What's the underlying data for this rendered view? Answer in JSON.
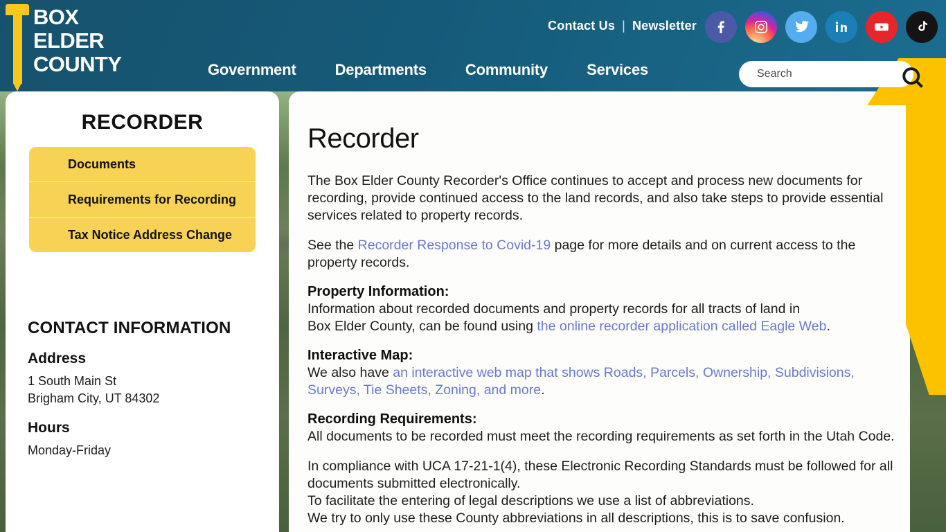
{
  "header": {
    "logo_lines": [
      "BOX",
      "ELDER",
      "COUNTY"
    ],
    "logo_icon": "nail-icon",
    "utility": {
      "contact_label": "Contact Us",
      "separator": "|",
      "newsletter_label": "Newsletter"
    },
    "socials": [
      {
        "name": "facebook",
        "label": "Facebook",
        "color": "#4b5aa7"
      },
      {
        "name": "instagram",
        "label": "Instagram",
        "color": "#d6249f"
      },
      {
        "name": "twitter",
        "label": "Twitter",
        "color": "#55acee"
      },
      {
        "name": "linkedin",
        "label": "LinkedIn",
        "color": "#1c7eb6"
      },
      {
        "name": "youtube",
        "label": "YouTube",
        "color": "#e8252a"
      },
      {
        "name": "tiktok",
        "label": "TikTok",
        "color": "#151314"
      }
    ],
    "nav": [
      {
        "label": "Government"
      },
      {
        "label": "Departments"
      },
      {
        "label": "Community"
      },
      {
        "label": "Services"
      }
    ],
    "search": {
      "placeholder": "Search",
      "value": "",
      "icon": "magnifier-icon"
    },
    "colors": {
      "header_start": "#17526d",
      "header_end": "#1b6d90",
      "accent_yellow": "#fcc200"
    }
  },
  "sidebar": {
    "title": "RECORDER",
    "menu": [
      {
        "label": "Documents"
      },
      {
        "label": "Requirements for Recording"
      },
      {
        "label": "Tax Notice Address Change"
      }
    ],
    "contact": {
      "heading": "CONTACT INFORMATION",
      "address_label": "Address",
      "address_line1": "1 South Main St",
      "address_line2": "Brigham City, UT 84302",
      "hours_label": "Hours",
      "hours_line1": "Monday-Friday"
    },
    "menu_bg": "#f8d254"
  },
  "main": {
    "title": "Recorder",
    "intro_line1": "The Box Elder County Recorder's Office continues to accept and process new documents for",
    "intro_line2": "recording, provide continued access to the land records, and also take steps to provide essential",
    "intro_line3": "services related to property records.",
    "covid_prefix": "See the ",
    "covid_link": "Recorder Response to Covid-19",
    "covid_suffix": " page for more details and on current access to the",
    "covid_line2": "property records.",
    "property_heading": "Property Information:",
    "property_line1": "Information about recorded documents and property records for all tracts of land in",
    "property_line2_prefix": "Box Elder County, can be found using ",
    "property_line2_link": "the online recorder application called Eagle Web",
    "property_line2_suffix": ".",
    "map_heading": "Interactive Map:",
    "map_prefix": "We also have ",
    "map_link_line1": "an interactive web map that shows Roads, Parcels, Ownership, Subdivisions,",
    "map_link_line2": "Surveys, Tie Sheets, Zoning, and more",
    "map_suffix": ".",
    "req_heading": "Recording Requirements:",
    "req_line1": "All documents to be recorded must meet the recording requirements as set forth in the Utah Code.",
    "req_line2": "In compliance with UCA 17-21-1(4), these Electronic Recording Standards must be followed for all",
    "req_line3": "documents submitted electronically.",
    "req_line4": "To facilitate the entering of legal descriptions we use a list of abbreviations.",
    "req_line5": "We try to only use these County abbreviations in all descriptions, this is to save confusion.",
    "link_color": "#6a77d8"
  }
}
